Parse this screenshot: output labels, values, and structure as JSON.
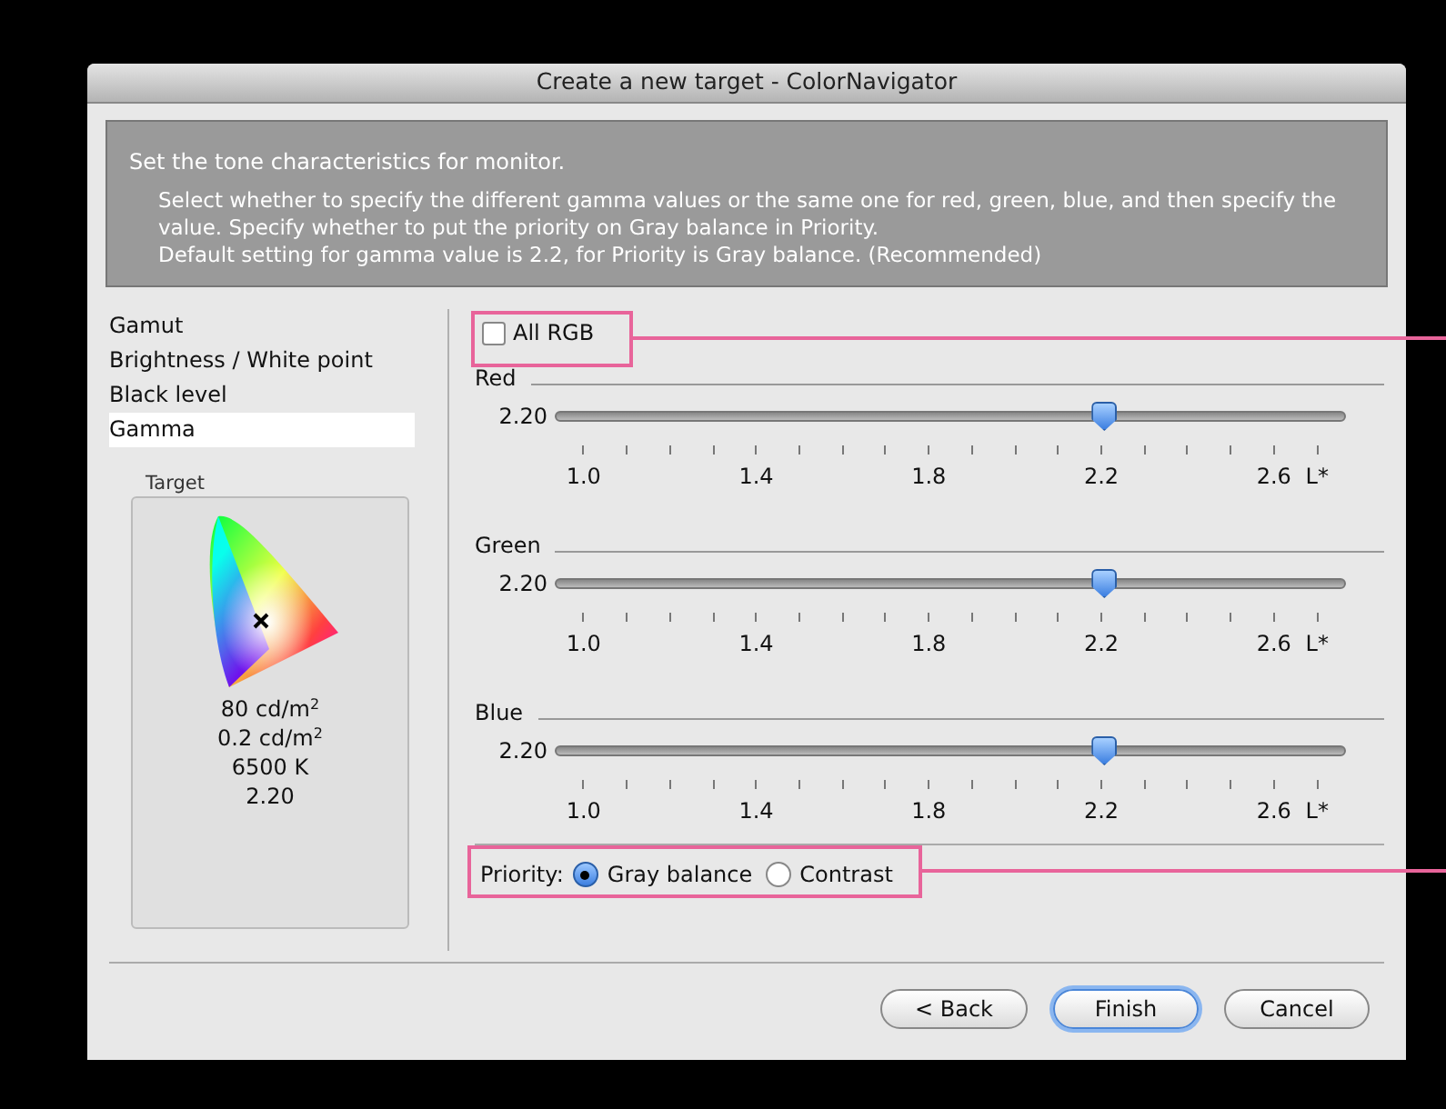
{
  "window": {
    "title": "Create a new target - ColorNavigator"
  },
  "info": {
    "heading": "Set the tone characteristics for monitor.",
    "lines": [
      "Select whether to specify the different gamma values or the same one for red, green, blue, and then specify the value. Specify whether to put the priority on Gray balance in Priority.",
      "Default setting for gamma value is 2.2, for Priority is Gray balance. (Recommended)"
    ]
  },
  "sidebar": {
    "items": [
      {
        "label": "Gamut",
        "selected": false
      },
      {
        "label": "Brightness / White point",
        "selected": false
      },
      {
        "label": "Black level",
        "selected": false
      },
      {
        "label": "Gamma",
        "selected": true
      }
    ]
  },
  "target": {
    "title": "Target",
    "values": [
      "80 cd/m$^{2}$",
      "0.2 cd/m$^{2}$",
      "6500 K",
      "2.20"
    ]
  },
  "all_rgb": {
    "label": "All RGB",
    "checked": false
  },
  "channels": [
    {
      "name": "Red",
      "reading": "2.20",
      "level": 0.706,
      "scale": [
        "1.0",
        "1.4",
        "1.8",
        "2.2",
        "2.6",
        "L*"
      ]
    },
    {
      "name": "Green",
      "reading": "2.20",
      "level": 0.706,
      "scale": [
        "1.0",
        "1.4",
        "1.8",
        "2.2",
        "2.6",
        "L*"
      ]
    },
    {
      "name": "Blue",
      "reading": "2.20",
      "level": 0.706,
      "scale": [
        "1.0",
        "1.4",
        "1.8",
        "2.2",
        "2.6",
        "L*"
      ]
    }
  ],
  "priority": {
    "label": "Priority:",
    "options": [
      {
        "label": "Gray balance",
        "selected": true
      },
      {
        "label": "Contrast",
        "selected": false
      }
    ]
  },
  "buttons": [
    {
      "label": "< Back",
      "kind": "normal"
    },
    {
      "label": "Finish",
      "kind": "default"
    },
    {
      "label": "Cancel",
      "kind": "normal"
    }
  ]
}
